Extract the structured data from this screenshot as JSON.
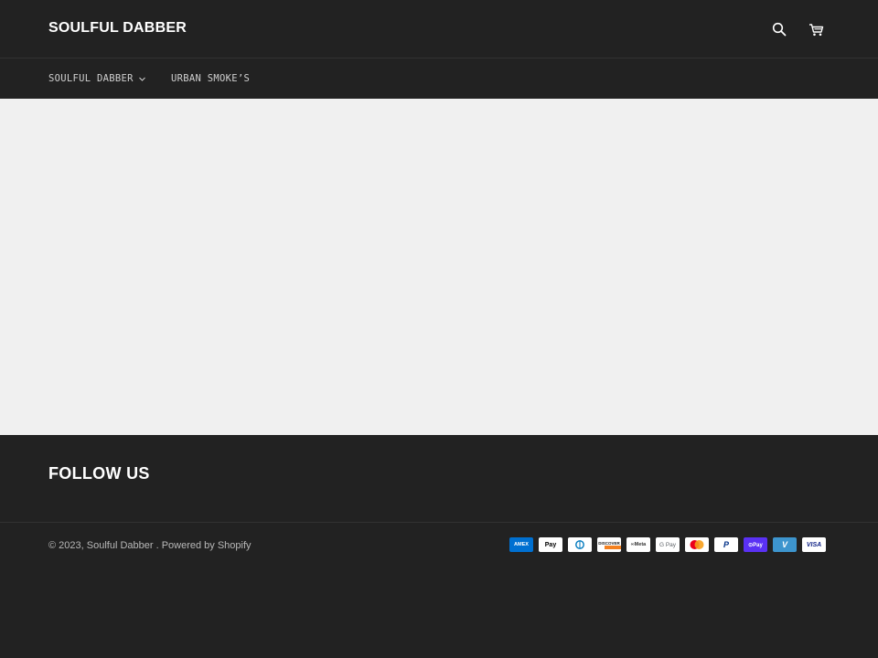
{
  "header": {
    "logo": "SOULFUL DABBER",
    "search_icon": "search-icon",
    "cart_icon": "cart-icon"
  },
  "nav": {
    "items": [
      {
        "label": "SOULFUL DABBER",
        "has_dropdown": true
      },
      {
        "label": "URBAN SMOKE’S",
        "has_dropdown": false
      }
    ]
  },
  "footer": {
    "follow_heading": "FOLLOW US",
    "copyright_prefix": "© 2023, ",
    "store_name": "Soulful Dabber",
    "separator": " . ",
    "powered_by": "Powered by Shopify",
    "payments": [
      {
        "name": "American Express",
        "label": "AMEX",
        "bg": "#0070D1",
        "fg": "#ffffff"
      },
      {
        "name": "Apple Pay",
        "label": " Pay",
        "bg": "#ffffff",
        "fg": "#000000"
      },
      {
        "name": "Diners Club",
        "label": "◐",
        "bg": "#ffffff",
        "fg": "#0079BE"
      },
      {
        "name": "Discover",
        "label": "DISCOVER",
        "bg": "#ffffff",
        "fg": "#222222"
      },
      {
        "name": "Meta Pay",
        "label": "∞Meta",
        "bg": "#ffffff",
        "fg": "#333333"
      },
      {
        "name": "Google Pay",
        "label": "G Pay",
        "bg": "#ffffff",
        "fg": "#5F6368"
      },
      {
        "name": "Mastercard",
        "label": "",
        "bg": "#ffffff",
        "fg": "#000000"
      },
      {
        "name": "PayPal",
        "label": "P",
        "bg": "#ffffff",
        "fg": "#003087"
      },
      {
        "name": "Shop Pay",
        "label": "⊙Pay",
        "bg": "#5A31F4",
        "fg": "#ffffff"
      },
      {
        "name": "Venmo",
        "label": "V",
        "bg": "#3D95CE",
        "fg": "#ffffff"
      },
      {
        "name": "Visa",
        "label": "VISA",
        "bg": "#ffffff",
        "fg": "#142688"
      }
    ]
  },
  "colors": {
    "header_bg": "#222222",
    "main_bg": "#f0f0f0",
    "footer_bg": "#222222"
  }
}
